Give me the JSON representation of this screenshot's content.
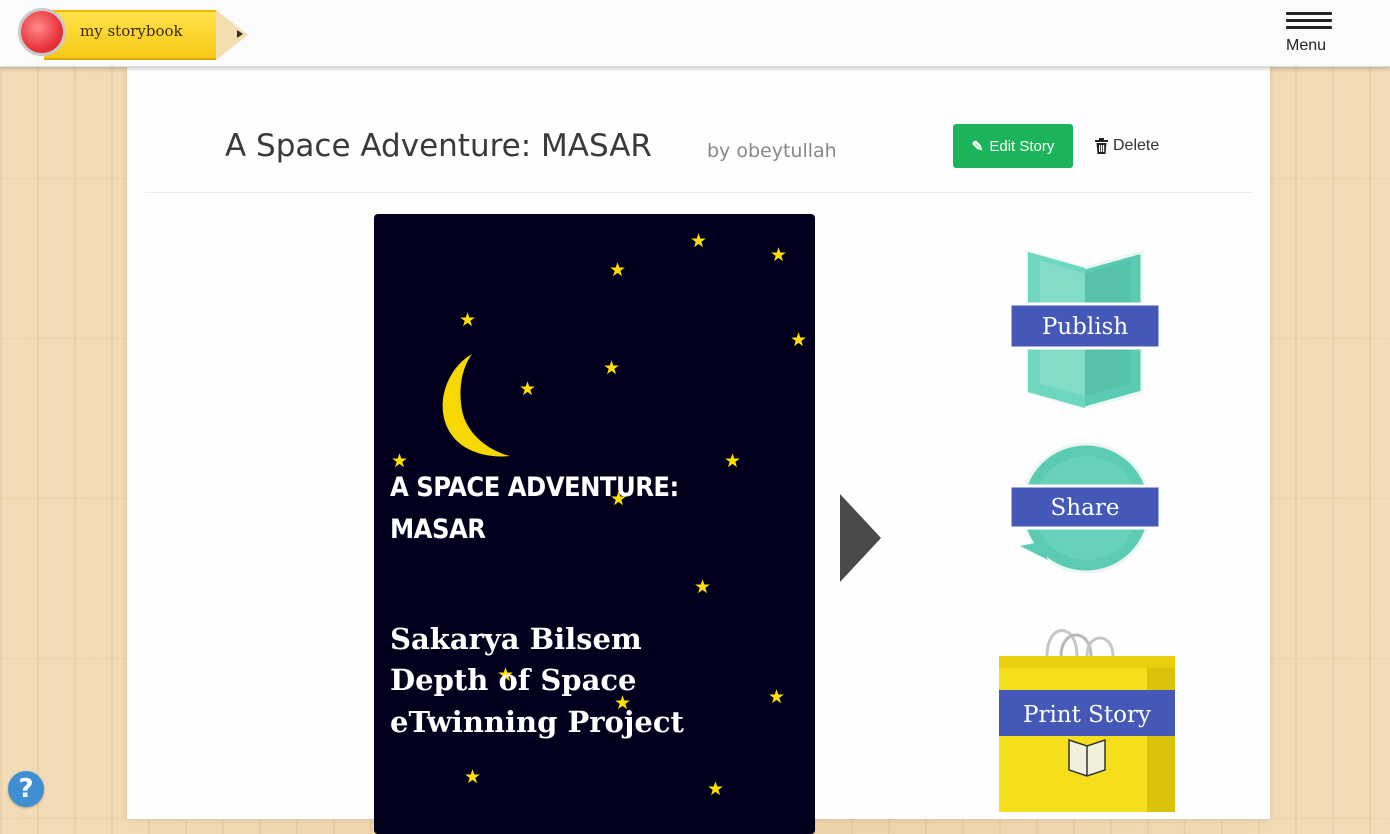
{
  "header": {
    "logo_text": "my storybook",
    "menu_label": "Menu"
  },
  "story": {
    "title": "A Space Adventure: MASAR",
    "byline": "by obeytullah",
    "edit_label": "Edit Story",
    "delete_label": "Delete"
  },
  "cover": {
    "title_line1": "A SPACE ADVENTURE:",
    "title_line2": "MASAR",
    "sub_line1": "Sakarya Bilsem",
    "sub_line2": "Depth of Space",
    "sub_line3": "eTwinning Project"
  },
  "actions": {
    "publish_label": "Publish",
    "share_label": "Share",
    "print_label": "Print Story"
  },
  "icons": {
    "edit": "edit-icon",
    "delete": "trash-icon",
    "menu": "hamburger-icon",
    "next": "next-arrow-icon",
    "help": "help-icon"
  },
  "colors": {
    "accent_green": "#1bb45a",
    "cover_bg": "#03001e",
    "star": "#ffe000",
    "teal": "#5ccbb3",
    "ribbon_blue": "#4458b8",
    "bag_yellow": "#f5de1c"
  }
}
